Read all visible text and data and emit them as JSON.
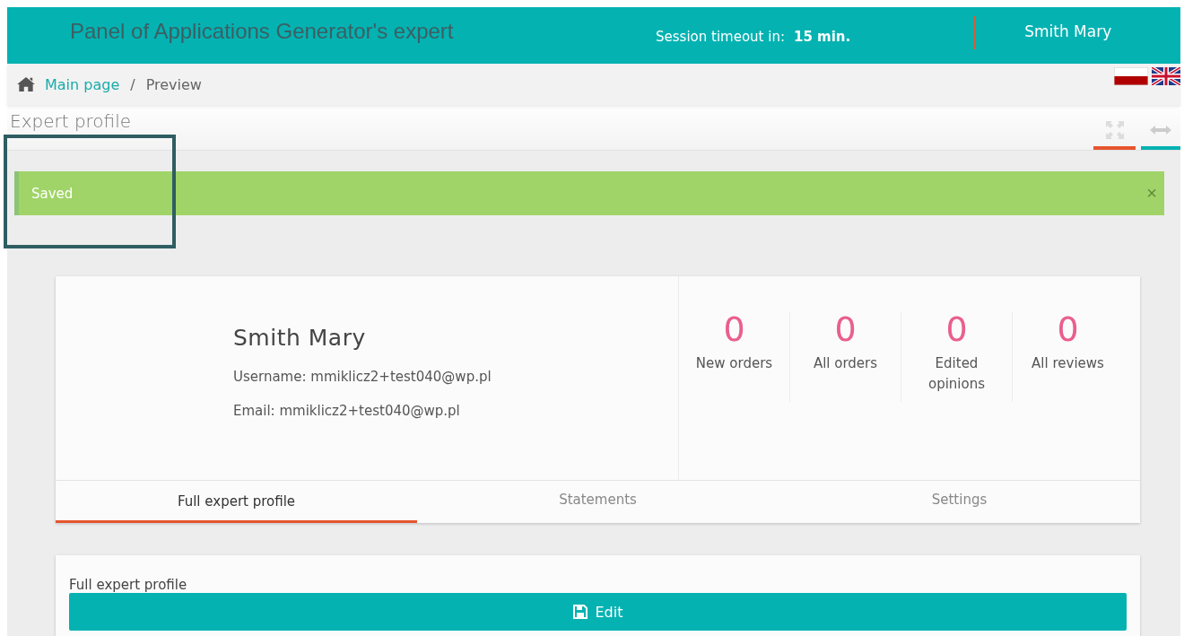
{
  "header": {
    "title": "Panel of Applications Generator's expert",
    "session_label": "Session timeout in:",
    "session_value": "15 min.",
    "user": "Smith Mary"
  },
  "breadcrumb": [
    {
      "label": "Main page",
      "kind": "link"
    },
    {
      "label": "Preview",
      "kind": "current"
    }
  ],
  "breadcrumb_separator": "/",
  "page_title": "Expert profile",
  "alert": {
    "text": "Saved",
    "close": "×"
  },
  "profile": {
    "name": "Smith Mary",
    "username": "Username: mmiklicz2+test040@wp.pl",
    "email": "Email: mmiklicz2+test040@wp.pl"
  },
  "stats": [
    {
      "value": "0",
      "label": "New orders"
    },
    {
      "value": "0",
      "label": "All orders"
    },
    {
      "value": "0",
      "label": "Edited opinions"
    },
    {
      "value": "0",
      "label": "All reviews"
    }
  ],
  "tabs": [
    {
      "label": "Full expert profile",
      "selected": true
    },
    {
      "label": "Statements",
      "selected": false
    },
    {
      "label": "Settings",
      "selected": false
    }
  ],
  "section": {
    "title": "Full expert profile",
    "button": "Edit"
  }
}
